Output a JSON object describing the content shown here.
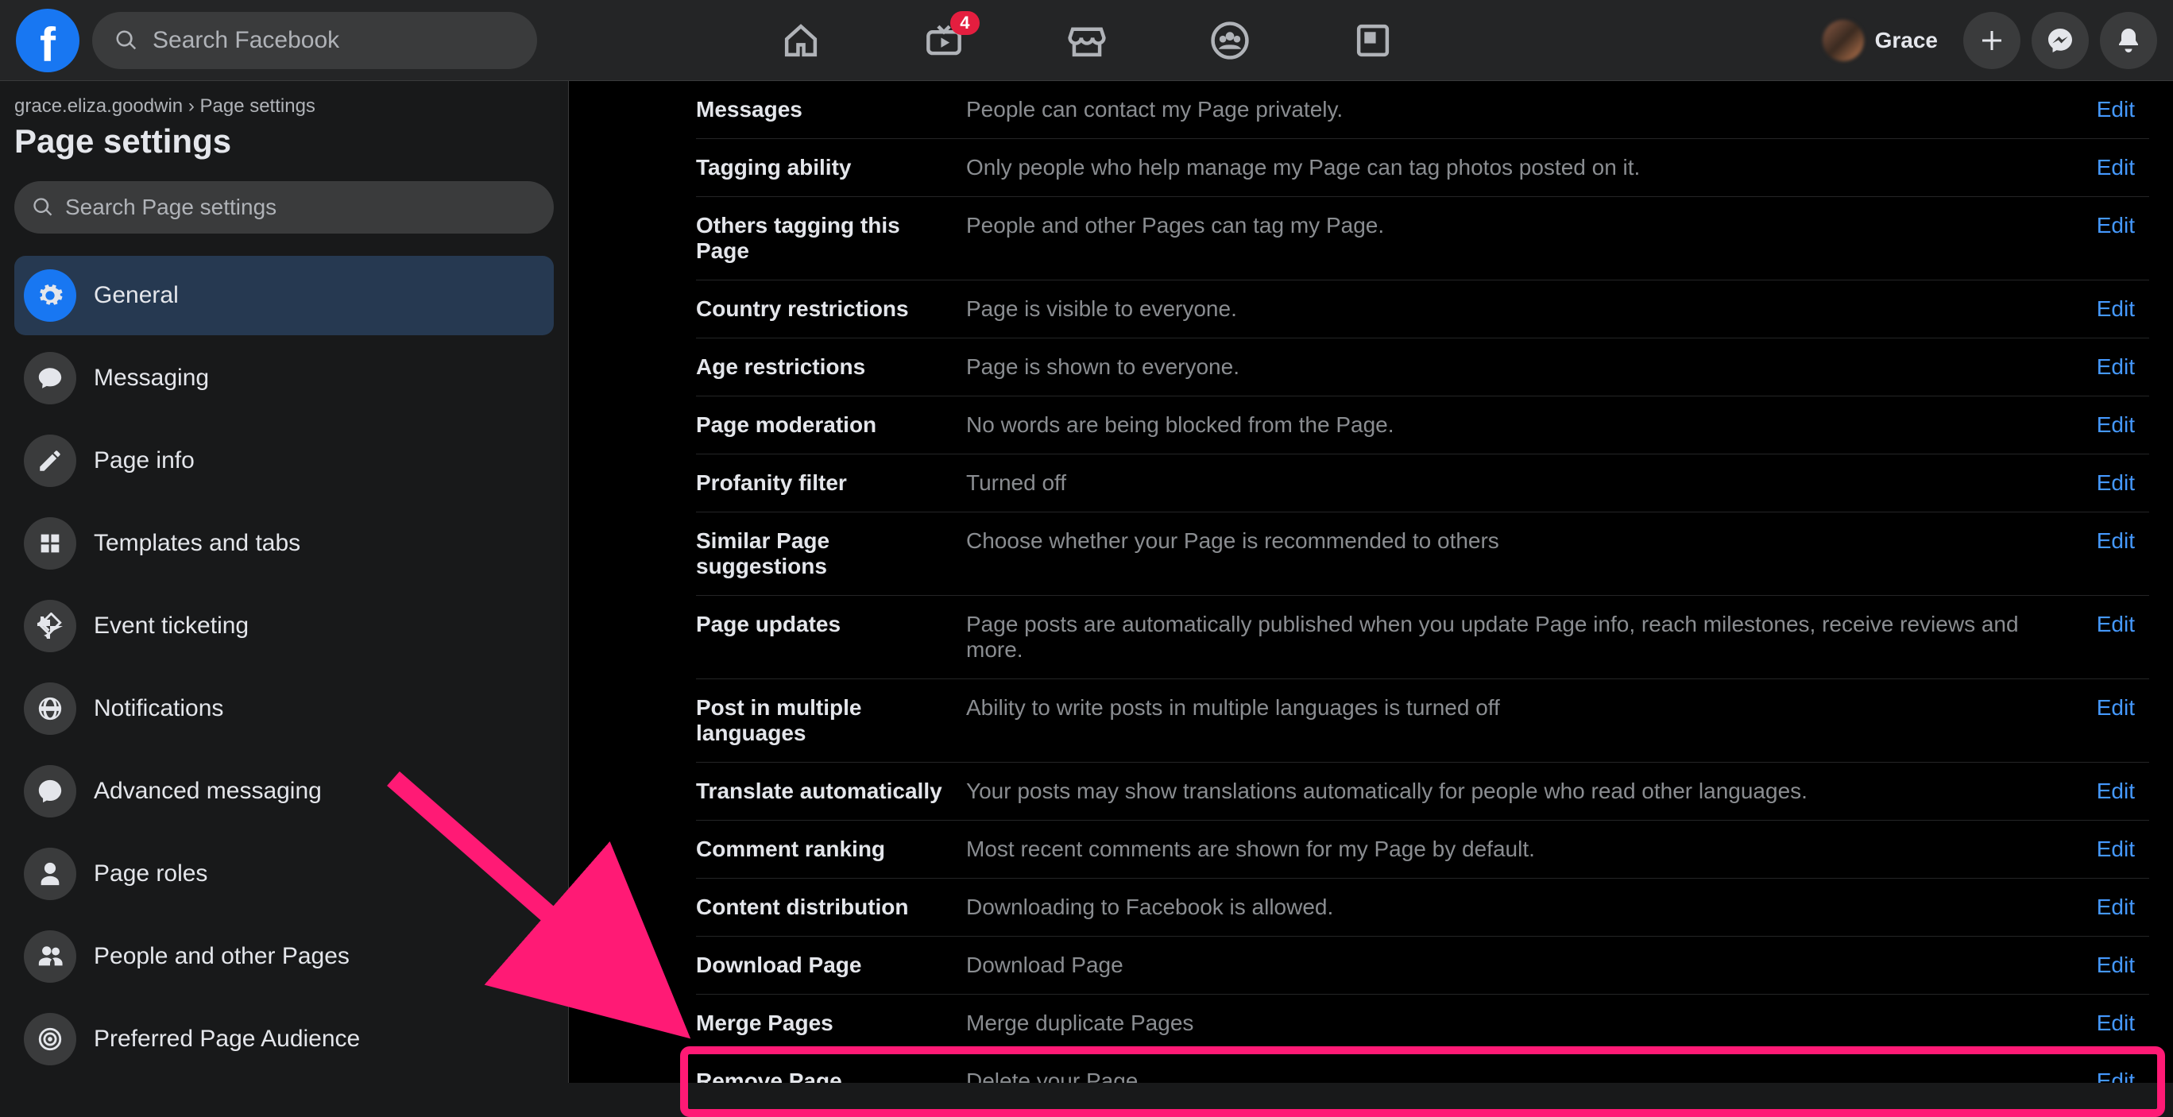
{
  "topbar": {
    "search_placeholder": "Search Facebook",
    "watch_badge": "4",
    "user_name": "Grace"
  },
  "breadcrumb": {
    "root": "grace.eliza.goodwin",
    "sep": "›",
    "current": "Page settings"
  },
  "page_title": "Page settings",
  "side_search_placeholder": "Search Page settings",
  "sidebar_items": [
    {
      "key": "general",
      "label": "General",
      "icon": "gear",
      "active": true
    },
    {
      "key": "messaging",
      "label": "Messaging",
      "icon": "chat",
      "active": false
    },
    {
      "key": "pageinfo",
      "label": "Page info",
      "icon": "pencil",
      "active": false
    },
    {
      "key": "templates",
      "label": "Templates and tabs",
      "icon": "grid",
      "active": false
    },
    {
      "key": "ticketing",
      "label": "Event ticketing",
      "icon": "ticket",
      "active": false
    },
    {
      "key": "notifs",
      "label": "Notifications",
      "icon": "globe",
      "active": false
    },
    {
      "key": "advmsg",
      "label": "Advanced messaging",
      "icon": "chat2",
      "active": false
    },
    {
      "key": "roles",
      "label": "Page roles",
      "icon": "person",
      "active": false
    },
    {
      "key": "people",
      "label": "People and other Pages",
      "icon": "people",
      "active": false
    },
    {
      "key": "audience",
      "label": "Preferred Page Audience",
      "icon": "target",
      "active": false
    }
  ],
  "settings_rows": [
    {
      "key": "Messages",
      "value": "People can contact my Page privately.",
      "action": "Edit"
    },
    {
      "key": "Tagging ability",
      "value": "Only people who help manage my Page can tag photos posted on it.",
      "action": "Edit"
    },
    {
      "key": "Others tagging this Page",
      "value": "People and other Pages can tag my Page.",
      "action": "Edit"
    },
    {
      "key": "Country restrictions",
      "value": "Page is visible to everyone.",
      "action": "Edit"
    },
    {
      "key": "Age restrictions",
      "value": "Page is shown to everyone.",
      "action": "Edit"
    },
    {
      "key": "Page moderation",
      "value": "No words are being blocked from the Page.",
      "action": "Edit"
    },
    {
      "key": "Profanity filter",
      "value": "Turned off",
      "action": "Edit"
    },
    {
      "key": "Similar Page suggestions",
      "value": "Choose whether your Page is recommended to others",
      "action": "Edit"
    },
    {
      "key": "Page updates",
      "value": "Page posts are automatically published when you update Page info, reach milestones, receive reviews and more.",
      "action": "Edit"
    },
    {
      "key": "Post in multiple languages",
      "value": "Ability to write posts in multiple languages is turned off",
      "action": "Edit"
    },
    {
      "key": "Translate automatically",
      "value": "Your posts may show translations automatically for people who read other languages.",
      "action": "Edit"
    },
    {
      "key": "Comment ranking",
      "value": "Most recent comments are shown for my Page by default.",
      "action": "Edit"
    },
    {
      "key": "Content distribution",
      "value": "Downloading to Facebook is allowed.",
      "action": "Edit"
    },
    {
      "key": "Download Page",
      "value": "Download Page",
      "action": "Edit"
    },
    {
      "key": "Merge Pages",
      "value": "Merge duplicate Pages",
      "action": "Edit"
    },
    {
      "key": "Remove Page",
      "value": "Delete your Page",
      "action": "Edit",
      "highlight": true
    }
  ],
  "colors": {
    "accent": "#1877f2",
    "link": "#4599ff",
    "highlight": "#ff1a75",
    "badge": "#e41e3f"
  }
}
